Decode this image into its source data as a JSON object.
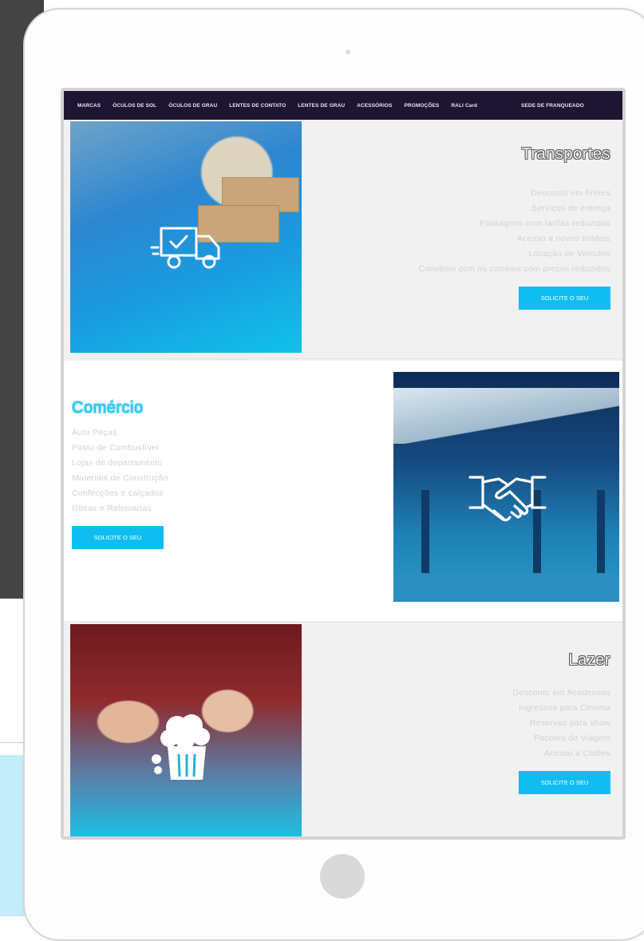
{
  "nav": {
    "items": [
      "MARCAS",
      "ÓCULOS DE SOL",
      "ÓCULOS DE GRAU",
      "LENTES DE CONTATO",
      "LENTES DE GRAU",
      "ACESSÓRIOS",
      "PROMOÇÕES",
      "RALI Card",
      "SEDE DE FRANQUEADO"
    ]
  },
  "sections": {
    "transportes": {
      "title": "Transportes",
      "items": [
        "Desconto em Fretes",
        "Serviços de entrega",
        "Passagens com tarifas reduzidas",
        "Acesso a novos modais",
        "Locação de Veículos",
        "Convênio com os correios com preços reduzidos"
      ],
      "button": "SOLICITE O SEU",
      "icon": "delivery-truck-icon"
    },
    "comercio": {
      "title": "Comércio",
      "items": [
        "Auto Peças",
        "Posto de Combustível",
        "Lojas de departamento",
        "Materiais de Construção",
        "Confecções e calçados",
        "Óticas e Relojoarias"
      ],
      "button": "SOLICITE O SEU",
      "icon": "handshake-icon"
    },
    "lazer": {
      "title": "Lazer",
      "items": [
        "Desconto em Academias",
        "Ingressos para Cinema",
        "Reservas para show",
        "Pacotes de Viagem",
        "Acesso a Clubes"
      ],
      "button": "SOLICITE O SEU",
      "icon": "popcorn-icon"
    }
  },
  "colors": {
    "nav_bg": "#1e1533",
    "accent": "#10bdf0",
    "title_cyan": "#29c6f2",
    "panel_bg": "#f1f1f1"
  }
}
